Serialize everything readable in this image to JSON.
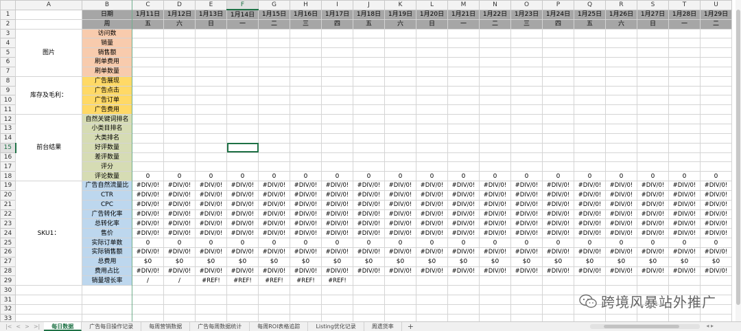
{
  "columns": [
    "A",
    "B",
    "C",
    "D",
    "E",
    "F",
    "G",
    "H",
    "I",
    "J",
    "K",
    "L",
    "M",
    "N",
    "O",
    "P",
    "Q",
    "R",
    "S",
    "T",
    "U"
  ],
  "selected_column": "F",
  "selected_row": 15,
  "row_numbers": [
    1,
    2,
    3,
    4,
    5,
    6,
    7,
    8,
    9,
    10,
    11,
    12,
    13,
    14,
    15,
    16,
    17,
    18,
    19,
    20,
    21,
    22,
    23,
    24,
    25,
    26,
    27,
    28,
    29,
    30,
    31,
    32,
    33
  ],
  "dates": [
    "1月11日",
    "1月12日",
    "1月13日",
    "1月14日",
    "1月15日",
    "1月16日",
    "1月17日",
    "1月18日",
    "1月19日",
    "1月20日",
    "1月21日",
    "1月22日",
    "1月23日",
    "1月24日",
    "1月25日",
    "1月26日",
    "1月27日",
    "1月28日",
    "1月29日"
  ],
  "weekdays": [
    "五",
    "六",
    "日",
    "一",
    "二",
    "三",
    "四",
    "五",
    "六",
    "日",
    "一",
    "二",
    "三",
    "四",
    "五",
    "六",
    "日",
    "一",
    "二"
  ],
  "header_labels": {
    "date": "日期",
    "week": "周"
  },
  "groups": [
    {
      "label": "图片",
      "start": 3,
      "span": 5
    },
    {
      "label": "库存及毛利：",
      "start": 8,
      "span": 4
    },
    {
      "label": "前台结果",
      "start": 12,
      "span": 7
    },
    {
      "label": "SKU1：",
      "start": 19,
      "span": 11
    }
  ],
  "metrics": [
    {
      "row": 3,
      "label": "访问数",
      "color": "pink",
      "value": ""
    },
    {
      "row": 4,
      "label": "销量",
      "color": "pink",
      "value": ""
    },
    {
      "row": 5,
      "label": "销售额",
      "color": "pink",
      "value": ""
    },
    {
      "row": 6,
      "label": "刷单费用",
      "color": "pink",
      "value": ""
    },
    {
      "row": 7,
      "label": "刷单数量",
      "color": "pink",
      "value": ""
    },
    {
      "row": 8,
      "label": "广告展现",
      "color": "yellow",
      "value": ""
    },
    {
      "row": 9,
      "label": "广告点击",
      "color": "yellow",
      "value": ""
    },
    {
      "row": 10,
      "label": "广告订单",
      "color": "yellow",
      "value": ""
    },
    {
      "row": 11,
      "label": "广告费用",
      "color": "yellow",
      "value": ""
    },
    {
      "row": 12,
      "label": "自然关键词排名",
      "color": "green",
      "value": ""
    },
    {
      "row": 13,
      "label": "小类目排名",
      "color": "green",
      "value": ""
    },
    {
      "row": 14,
      "label": "大类排名",
      "color": "green",
      "value": ""
    },
    {
      "row": 15,
      "label": "好评数量",
      "color": "green",
      "value": ""
    },
    {
      "row": 16,
      "label": "差评数量",
      "color": "green",
      "value": ""
    },
    {
      "row": 17,
      "label": "评分",
      "color": "green",
      "value": ""
    },
    {
      "row": 18,
      "label": "评论数量",
      "color": "green",
      "value": "0"
    },
    {
      "row": 19,
      "label": "广告自然流量比",
      "color": "blue",
      "value": "#DIV/0!"
    },
    {
      "row": 20,
      "label": "CTR",
      "color": "blue",
      "value": "#DIV/0!"
    },
    {
      "row": 21,
      "label": "CPC",
      "color": "blue",
      "value": "#DIV/0!"
    },
    {
      "row": 22,
      "label": "广告转化率",
      "color": "blue",
      "value": "#DIV/0!"
    },
    {
      "row": 23,
      "label": "总转化率",
      "color": "blue",
      "value": "#DIV/0!"
    },
    {
      "row": 24,
      "label": "售价",
      "color": "blue",
      "value": "#DIV/0!"
    },
    {
      "row": 25,
      "label": "实际订单数",
      "color": "blue",
      "value": "0"
    },
    {
      "row": 26,
      "label": "实际销售额",
      "color": "blue",
      "value": "#DIV/0!"
    },
    {
      "row": 27,
      "label": "总费用",
      "color": "blue",
      "value": "$0"
    },
    {
      "row": 28,
      "label": "费用占比",
      "color": "blue",
      "value": "#DIV/0!"
    },
    {
      "row": 29,
      "label": "销量增长率",
      "color": "blue",
      "values": [
        "/",
        "/",
        "#REF!",
        "#REF!",
        "#REF!",
        "#REF!",
        "#REF!",
        "",
        "",
        "",
        "",
        "",
        "",
        "",
        "",
        "",
        "",
        "",
        ""
      ]
    }
  ],
  "sheet_tabs": [
    "每日数据",
    "广告每日操作记录",
    "每周营销数据",
    "广告每周数据统计",
    "每周ROI表格追踪",
    "Listing优化记录",
    "周遗货率"
  ],
  "active_tab": 0,
  "nav_arrows": [
    "|<",
    "<",
    ">",
    ">|"
  ],
  "add_tab_label": "+",
  "watermark_text": "跨境风暴站外推广",
  "colors": {
    "accent": "#1e7145",
    "pink": "#f8cbad",
    "yellow": "#ffd966",
    "green": "#d6dcb4",
    "blue": "#bdd7ee",
    "gray": "#a6a6a6"
  }
}
